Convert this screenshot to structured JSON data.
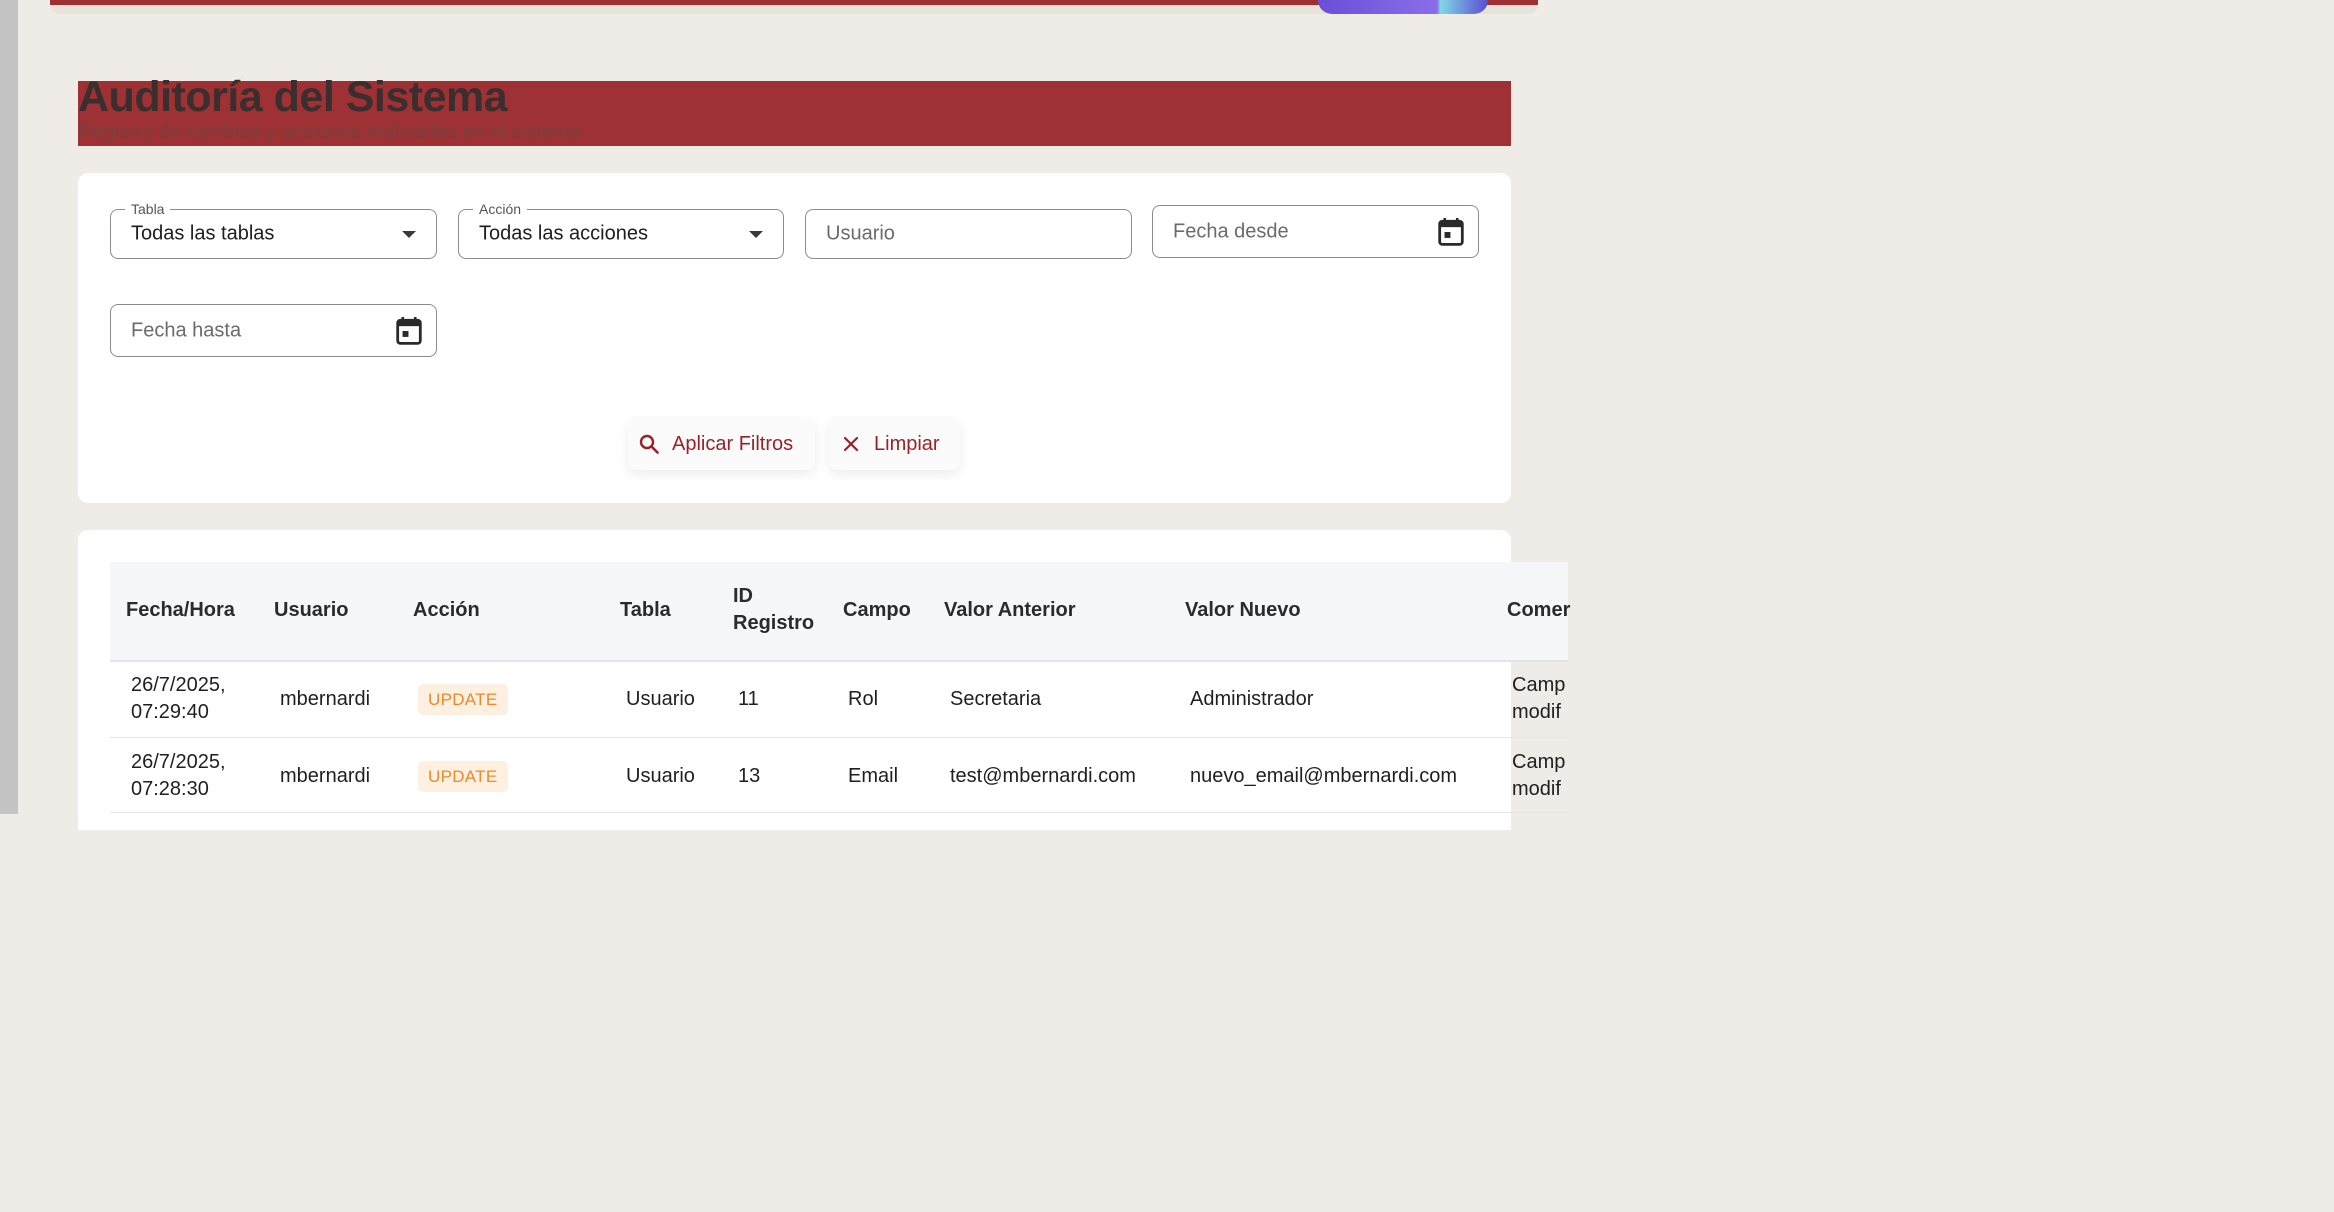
{
  "page": {
    "title": "Auditoría del Sistema",
    "subtitle": "Registro de cambios y acciones realizadas en el sistema"
  },
  "filters": {
    "table": {
      "label": "Tabla",
      "value": "Todas las tablas"
    },
    "action": {
      "label": "Acción",
      "value": "Todas las acciones"
    },
    "user": {
      "placeholder": "Usuario"
    },
    "date_from": {
      "placeholder": "Fecha desde"
    },
    "date_to": {
      "placeholder": "Fecha hasta"
    },
    "apply_label": "Aplicar Filtros",
    "clear_label": "Limpiar"
  },
  "table": {
    "headers": {
      "datetime": "Fecha/Hora",
      "user": "Usuario",
      "action": "Acción",
      "table": "Tabla",
      "record_id_1": "ID",
      "record_id_2": "Registro",
      "field": "Campo",
      "old_value": "Valor Anterior",
      "new_value": "Valor Nuevo",
      "comment": "Comer"
    },
    "rows": [
      {
        "date": "26/7/2025,",
        "time": "07:29:40",
        "user": "mbernardi",
        "action": "UPDATE",
        "table": "Usuario",
        "record_id": "11",
        "field": "Rol",
        "old_value": "Secretaria",
        "new_value": "Administrador",
        "comment_1": "Camp",
        "comment_2": "modif"
      },
      {
        "date": "26/7/2025,",
        "time": "07:28:30",
        "user": "mbernardi",
        "action": "UPDATE",
        "table": "Usuario",
        "record_id": "13",
        "field": "Email",
        "old_value": "test@mbernardi.com",
        "new_value": "nuevo_email@mbernardi.com",
        "comment_1": "Camp",
        "comment_2": "modif"
      }
    ]
  },
  "colors": {
    "brand": "#9e3134",
    "accent_text": "#9a2226",
    "badge_bg": "#fdf0e1",
    "badge_text": "#ea8a2b",
    "background": "#efebe6"
  }
}
